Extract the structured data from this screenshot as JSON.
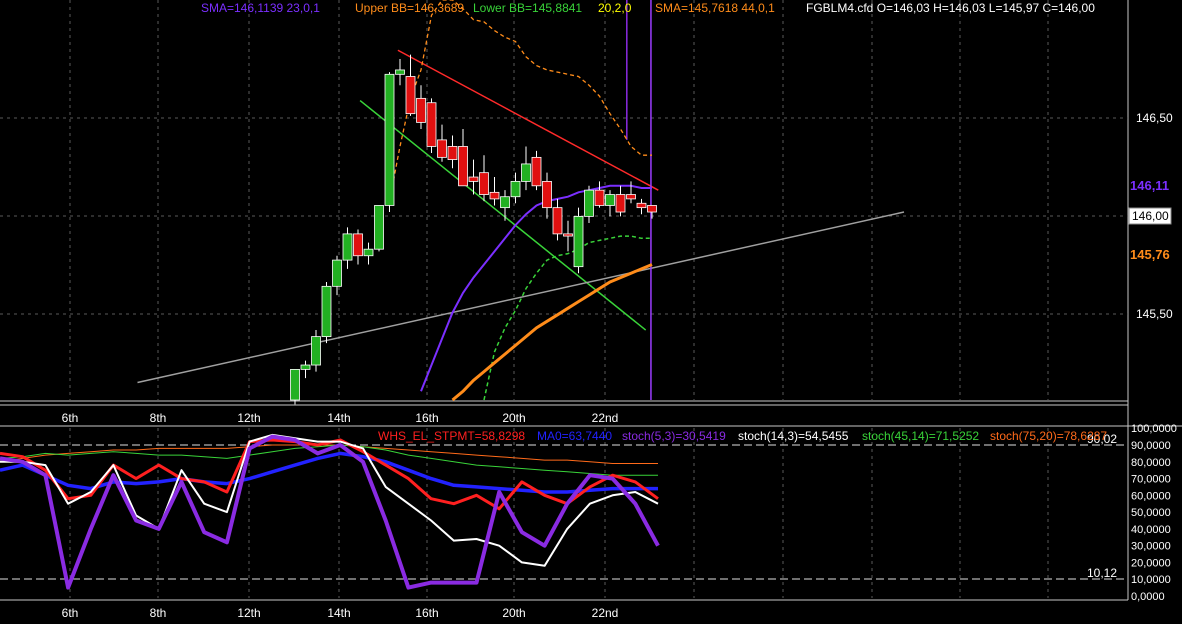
{
  "main_legend": [
    {
      "text": "SMA=146,1139  23,0,1",
      "color": "#7b2fff"
    },
    {
      "text": "Upper BB=146,3689",
      "color": "#ff8c1a"
    },
    {
      "text": "Lower BB=145,8841",
      "color": "#39d339"
    },
    {
      "text": "20,2,0",
      "color": "#ffff00"
    },
    {
      "text": "SMA=145,7618  44,0,1",
      "color": "#ff8c1a"
    },
    {
      "text": "FGBLM4.cfd O=146,03 H=146,03 L=145,97 C=146,00",
      "color": "#ffffff"
    }
  ],
  "osc_legend": [
    {
      "text": "WHS_EL_STPMT=58,8298",
      "color": "#ff2020"
    },
    {
      "text": "MA0=63,7440",
      "color": "#2222ff"
    },
    {
      "text": "stoch(5,3)=30,5419",
      "color": "#8a2be2"
    },
    {
      "text": "stoch(14,3)=54,5455",
      "color": "#ffffff"
    },
    {
      "text": "stoch(45,14)=71,5252",
      "color": "#39d339"
    },
    {
      "text": "stoch(75,20)=78,6287",
      "color": "#ff6a1a"
    }
  ],
  "price_badges": [
    {
      "text": "146,11",
      "color": "#7b2fff"
    },
    {
      "text": "146,00",
      "color": "#000000"
    },
    {
      "text": "145,76",
      "color": "#ff8c1a"
    }
  ],
  "osc_levels": [
    "90,02",
    "10,12"
  ],
  "date_labels": [
    "6th",
    "8th",
    "12th",
    "14th",
    "16th",
    "20th",
    "22nd"
  ],
  "chart_data": [
    {
      "type": "candlestick",
      "symbol": "FGBLM4.cfd",
      "y_tick_labels": [
        "146,50",
        "145,50"
      ],
      "ylim": [
        145.14,
        146.97
      ],
      "candles": [
        {
          "o": 145.14,
          "h": 145.28,
          "l": 145.12,
          "c": 145.28
        },
        {
          "o": 145.28,
          "h": 145.32,
          "l": 145.24,
          "c": 145.3
        },
        {
          "o": 145.3,
          "h": 145.46,
          "l": 145.27,
          "c": 145.43
        },
        {
          "o": 145.43,
          "h": 145.68,
          "l": 145.4,
          "c": 145.66
        },
        {
          "o": 145.66,
          "h": 145.8,
          "l": 145.62,
          "c": 145.78
        },
        {
          "o": 145.78,
          "h": 145.93,
          "l": 145.74,
          "c": 145.9
        },
        {
          "o": 145.9,
          "h": 145.92,
          "l": 145.76,
          "c": 145.8
        },
        {
          "o": 145.8,
          "h": 145.86,
          "l": 145.76,
          "c": 145.83
        },
        {
          "o": 145.83,
          "h": 146.03,
          "l": 145.82,
          "c": 146.03
        },
        {
          "o": 146.03,
          "h": 146.64,
          "l": 146.0,
          "c": 146.63
        },
        {
          "o": 146.63,
          "h": 146.7,
          "l": 146.58,
          "c": 146.65
        },
        {
          "o": 146.62,
          "h": 146.72,
          "l": 146.44,
          "c": 146.45
        },
        {
          "o": 146.52,
          "h": 146.58,
          "l": 146.38,
          "c": 146.41
        },
        {
          "o": 146.5,
          "h": 146.52,
          "l": 146.27,
          "c": 146.3
        },
        {
          "o": 146.33,
          "h": 146.4,
          "l": 146.23,
          "c": 146.25
        },
        {
          "o": 146.3,
          "h": 146.35,
          "l": 146.2,
          "c": 146.24
        },
        {
          "o": 146.3,
          "h": 146.38,
          "l": 146.13,
          "c": 146.12
        },
        {
          "o": 146.16,
          "h": 146.24,
          "l": 146.08,
          "c": 146.14
        },
        {
          "o": 146.18,
          "h": 146.26,
          "l": 146.05,
          "c": 146.08
        },
        {
          "o": 146.09,
          "h": 146.16,
          "l": 146.03,
          "c": 146.06
        },
        {
          "o": 146.02,
          "h": 146.1,
          "l": 145.96,
          "c": 146.07
        },
        {
          "o": 146.07,
          "h": 146.18,
          "l": 146.04,
          "c": 146.14
        },
        {
          "o": 146.14,
          "h": 146.3,
          "l": 146.1,
          "c": 146.22
        },
        {
          "o": 146.25,
          "h": 146.28,
          "l": 146.1,
          "c": 146.12
        },
        {
          "o": 146.14,
          "h": 146.18,
          "l": 145.97,
          "c": 146.02
        },
        {
          "o": 146.02,
          "h": 146.06,
          "l": 145.87,
          "c": 145.9
        },
        {
          "o": 145.9,
          "h": 145.96,
          "l": 145.82,
          "c": 145.89
        },
        {
          "o": 145.75,
          "h": 146.02,
          "l": 145.72,
          "c": 145.98
        },
        {
          "o": 145.98,
          "h": 146.12,
          "l": 145.95,
          "c": 146.1
        },
        {
          "o": 146.1,
          "h": 146.14,
          "l": 146.02,
          "c": 146.03
        },
        {
          "o": 146.03,
          "h": 146.1,
          "l": 145.98,
          "c": 146.08
        },
        {
          "o": 146.08,
          "h": 146.12,
          "l": 145.98,
          "c": 146.0
        },
        {
          "o": 146.08,
          "h": 146.14,
          "l": 146.04,
          "c": 146.06
        },
        {
          "o": 146.04,
          "h": 146.06,
          "l": 145.99,
          "c": 146.02
        },
        {
          "o": 146.03,
          "h": 146.03,
          "l": 145.97,
          "c": 146.0
        }
      ],
      "sma23": [
        null,
        null,
        null,
        null,
        null,
        null,
        null,
        null,
        null,
        null,
        null,
        null,
        145.18,
        145.3,
        145.42,
        145.54,
        145.63,
        145.7,
        145.76,
        145.82,
        145.88,
        145.94,
        145.99,
        146.03,
        146.05,
        146.06,
        146.07,
        146.09,
        146.1,
        146.11,
        146.12,
        146.12,
        146.12,
        146.11,
        146.11
      ],
      "sma44": [
        null,
        null,
        null,
        null,
        null,
        null,
        null,
        null,
        null,
        null,
        null,
        null,
        null,
        null,
        null,
        145.14,
        145.18,
        145.23,
        145.27,
        145.31,
        145.35,
        145.39,
        145.43,
        145.47,
        145.5,
        145.53,
        145.56,
        145.59,
        145.62,
        145.65,
        145.68,
        145.7,
        145.72,
        145.74,
        145.76
      ],
      "upper_bb": [
        null,
        null,
        null,
        null,
        null,
        null,
        null,
        null,
        null,
        146.05,
        146.3,
        146.52,
        146.65,
        146.9,
        146.97,
        146.97,
        146.93,
        146.88,
        146.87,
        146.83,
        146.8,
        146.78,
        146.71,
        146.67,
        146.65,
        146.64,
        146.63,
        146.62,
        146.58,
        146.53,
        146.45,
        146.38,
        146.3,
        146.26,
        146.26
      ],
      "lower_bb": [
        null,
        null,
        null,
        null,
        null,
        null,
        null,
        null,
        null,
        null,
        null,
        null,
        null,
        null,
        null,
        null,
        null,
        null,
        145.14,
        145.36,
        145.47,
        145.55,
        145.65,
        145.72,
        145.78,
        145.8,
        145.81,
        145.83,
        145.86,
        145.87,
        145.88,
        145.89,
        145.89,
        145.88,
        145.88
      ],
      "trendlines": [
        {
          "name": "resistance",
          "color": "#ff2a2a",
          "points": [
            [
              9.8,
              146.74
            ],
            [
              34.6,
              146.1
            ]
          ]
        },
        {
          "name": "support",
          "color": "#39d339",
          "points": [
            [
              6.2,
              146.51
            ],
            [
              33.4,
              145.46
            ]
          ]
        },
        {
          "name": "long-term",
          "color": "#a0a0a0",
          "points": [
            [
              -15,
              145.22
            ],
            [
              58,
              146.0
            ]
          ]
        },
        {
          "name": "vertical-violet",
          "color": "#8a2be2",
          "points": [
            [
              31.6,
              146.97
            ],
            [
              31.6,
              146.33
            ]
          ]
        },
        {
          "name": "vertical-violet-2",
          "color": "#9b3cff",
          "points": [
            [
              33.9,
              146.97
            ],
            [
              33.9,
              145.14
            ]
          ]
        }
      ]
    },
    {
      "type": "line",
      "y_tick_labels": [
        "100,0000",
        "90,0000",
        "80,0000",
        "70,0000",
        "60,0000",
        "50,0000",
        "40,0000",
        "30,0000",
        "20,0000",
        "10,0000",
        "0,0000"
      ],
      "ylim": [
        0,
        100
      ],
      "levels": [
        90.02,
        10.12
      ],
      "series": [
        {
          "name": "WHS_EL_STPMT",
          "color": "#ff2020",
          "values": [
            85,
            83,
            75,
            58,
            60,
            78,
            70,
            78,
            70,
            68,
            62,
            92,
            93,
            92,
            90,
            93,
            86,
            78,
            70,
            58,
            55,
            60,
            52,
            68,
            60,
            55,
            65,
            72,
            68,
            58
          ]
        },
        {
          "name": "MA0",
          "color": "#2222ff",
          "values": [
            75,
            78,
            72,
            66,
            64,
            68,
            67,
            68,
            70,
            68,
            67,
            70,
            74,
            78,
            82,
            85,
            83,
            80,
            75,
            70,
            66,
            65,
            64,
            63,
            62,
            62,
            63,
            64,
            64,
            64
          ]
        },
        {
          "name": "stoch(5,3)",
          "color": "#8a2be2",
          "values": [
            82,
            80,
            72,
            5,
            40,
            72,
            45,
            40,
            68,
            38,
            32,
            88,
            95,
            93,
            85,
            90,
            80,
            45,
            5,
            8,
            8,
            8,
            62,
            38,
            30,
            55,
            72,
            70,
            55,
            30
          ]
        },
        {
          "name": "stoch(14,3)",
          "color": "#ffffff",
          "values": [
            80,
            80,
            78,
            55,
            62,
            78,
            48,
            40,
            75,
            55,
            50,
            92,
            96,
            94,
            92,
            92,
            88,
            65,
            55,
            45,
            33,
            34,
            30,
            20,
            18,
            40,
            55,
            60,
            62,
            55
          ]
        },
        {
          "name": "stoch(45,14)",
          "color": "#39d339",
          "values": [
            82,
            83,
            85,
            84,
            85,
            86,
            85,
            84,
            84,
            83,
            82,
            84,
            86,
            88,
            89,
            90,
            89,
            87,
            84,
            82,
            80,
            78,
            77,
            76,
            75,
            74,
            73,
            72,
            72,
            72
          ]
        },
        {
          "name": "stoch(75,20)",
          "color": "#ff6a1a",
          "values": [
            80,
            82,
            84,
            85,
            86,
            87,
            87,
            88,
            88,
            88,
            88,
            89,
            90,
            90,
            90,
            90,
            89,
            88,
            87,
            86,
            85,
            84,
            83,
            82,
            81,
            81,
            80,
            79,
            79,
            79
          ]
        }
      ]
    }
  ]
}
